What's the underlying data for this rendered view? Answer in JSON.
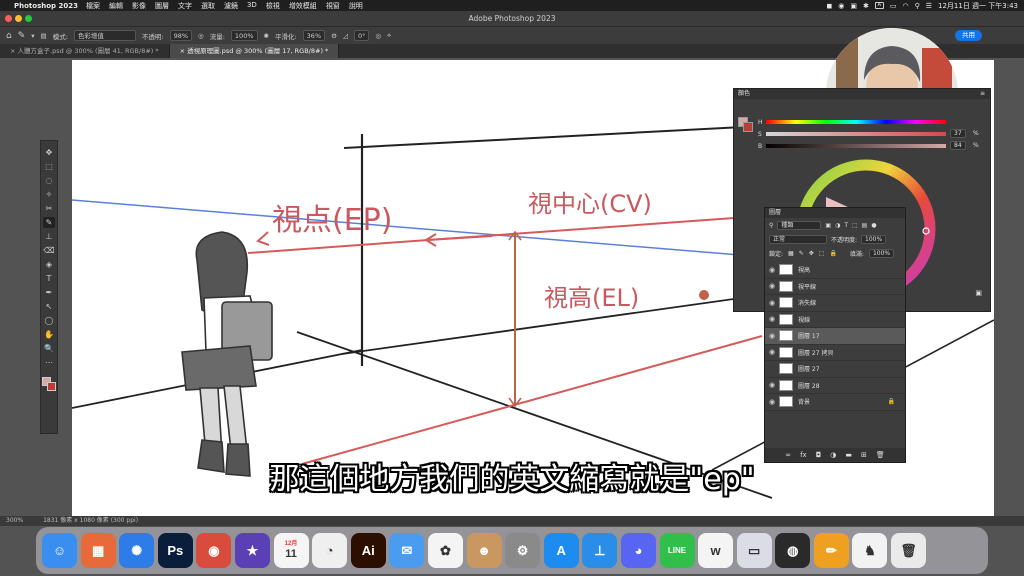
{
  "menubar": {
    "app_name": "Photoshop 2023",
    "items": [
      "檔案",
      "編輯",
      "影像",
      "圖層",
      "文字",
      "選取",
      "濾鏡",
      "3D",
      "檢視",
      "增效模組",
      "視窗",
      "說明"
    ],
    "clock": "12月11日 週一 下午3:43",
    "input_method": "A"
  },
  "window": {
    "title": "Adobe Photoshop 2023"
  },
  "options": {
    "mode_label": "模式:",
    "mode_value": "色彩增值",
    "opacity_label": "不透明:",
    "opacity_value": "98%",
    "flow_label": "流量:",
    "flow_value": "100%",
    "smooth_label": "平滑化:",
    "smooth_value": "36%",
    "angle_value": "0°",
    "share_label": "共用"
  },
  "tabs": [
    {
      "label": "人體方盒子.psd @ 300% (圖層 41, RGB/8#) *",
      "active": false
    },
    {
      "label": "透視原理圖.psd @ 300% (圖層 17, RGB/8#) *",
      "active": true
    }
  ],
  "tools": [
    "✥",
    "⬚",
    "◌",
    "✧",
    "✂",
    "✎",
    "⊥",
    "⌫",
    "◈",
    "T",
    "✒",
    "↖",
    "◯",
    "✋",
    "🔍",
    "⋯"
  ],
  "canvas": {
    "annotations": {
      "ep": "視点(EP)",
      "cv": "視中心(CV)",
      "el": "視高(EL)"
    }
  },
  "status": {
    "zoom": "300%",
    "doc_info": "1831 像素 x 1080 像素 (300 ppi)"
  },
  "color_panel": {
    "title": "顏色",
    "slider_h": "H",
    "slider_s": "S",
    "slider_b": "B",
    "s_value": "37",
    "b_value": "84",
    "unit": "%"
  },
  "layers_panel": {
    "title": "圖層",
    "filter_kind": "種類",
    "blend_mode": "正常",
    "opacity_label": "不透明度:",
    "opacity_value": "100%",
    "lock_label": "鎖定:",
    "fill_label": "填滿:",
    "fill_value": "100%",
    "layers": [
      {
        "name": "視高",
        "visible": true,
        "selected": false
      },
      {
        "name": "視平線",
        "visible": true,
        "selected": false
      },
      {
        "name": "消失線",
        "visible": true,
        "selected": false
      },
      {
        "name": "視線",
        "visible": true,
        "selected": false
      },
      {
        "name": "圖層 17",
        "visible": true,
        "selected": true
      },
      {
        "name": "圖層 27 拷貝",
        "visible": true,
        "selected": false
      },
      {
        "name": "圖層 27",
        "visible": false,
        "selected": false
      },
      {
        "name": "圖層 28",
        "visible": true,
        "selected": false
      },
      {
        "name": "背景",
        "visible": true,
        "selected": false,
        "locked": true
      }
    ]
  },
  "subtitle": "那這個地方我們的英文縮寫就是\"ep\"",
  "dock": {
    "apps": [
      {
        "name": "finder",
        "label": "☺",
        "color": "#3a8ef0"
      },
      {
        "name": "launchpad",
        "label": "▦",
        "color": "#e86a3a"
      },
      {
        "name": "safari",
        "label": "✺",
        "color": "#2d7ce8"
      },
      {
        "name": "photoshop",
        "label": "Ps",
        "color": "#0a1e3b"
      },
      {
        "name": "chrome",
        "label": "◉",
        "color": "#d94b3c"
      },
      {
        "name": "imovie",
        "label": "★",
        "color": "#5b3fb5"
      },
      {
        "name": "calendar",
        "label": "11",
        "color": "#f5f5f5"
      },
      {
        "name": "clip-studio",
        "label": "◔",
        "color": "#efefef"
      },
      {
        "name": "illustrator",
        "label": "Ai",
        "color": "#2d0f00"
      },
      {
        "name": "mail",
        "label": "✉",
        "color": "#4a9cf0"
      },
      {
        "name": "photos",
        "label": "✿",
        "color": "#f4f4f4"
      },
      {
        "name": "contacts",
        "label": "☻",
        "color": "#c89860"
      },
      {
        "name": "system-settings",
        "label": "⚙",
        "color": "#8a8a8a"
      },
      {
        "name": "app-store",
        "label": "A",
        "color": "#1e8bf0"
      },
      {
        "name": "keynote",
        "label": "⊥",
        "color": "#2a8ee8"
      },
      {
        "name": "discord",
        "label": "◕",
        "color": "#5865f2"
      },
      {
        "name": "line",
        "label": "LINE",
        "color": "#2fbf4a"
      },
      {
        "name": "word-app",
        "label": "w",
        "color": "#f4f4f4"
      },
      {
        "name": "preview",
        "label": "▭",
        "color": "#dcdce6"
      },
      {
        "name": "obs",
        "label": "◍",
        "color": "#2a2a2a"
      },
      {
        "name": "notes-pencil",
        "label": "✏",
        "color": "#f0a020"
      },
      {
        "name": "android-studio",
        "label": "♞",
        "color": "#f2f2f2"
      },
      {
        "name": "trash",
        "label": "🗑",
        "color": "#eaeaea"
      }
    ],
    "calendar_month": "12月"
  }
}
